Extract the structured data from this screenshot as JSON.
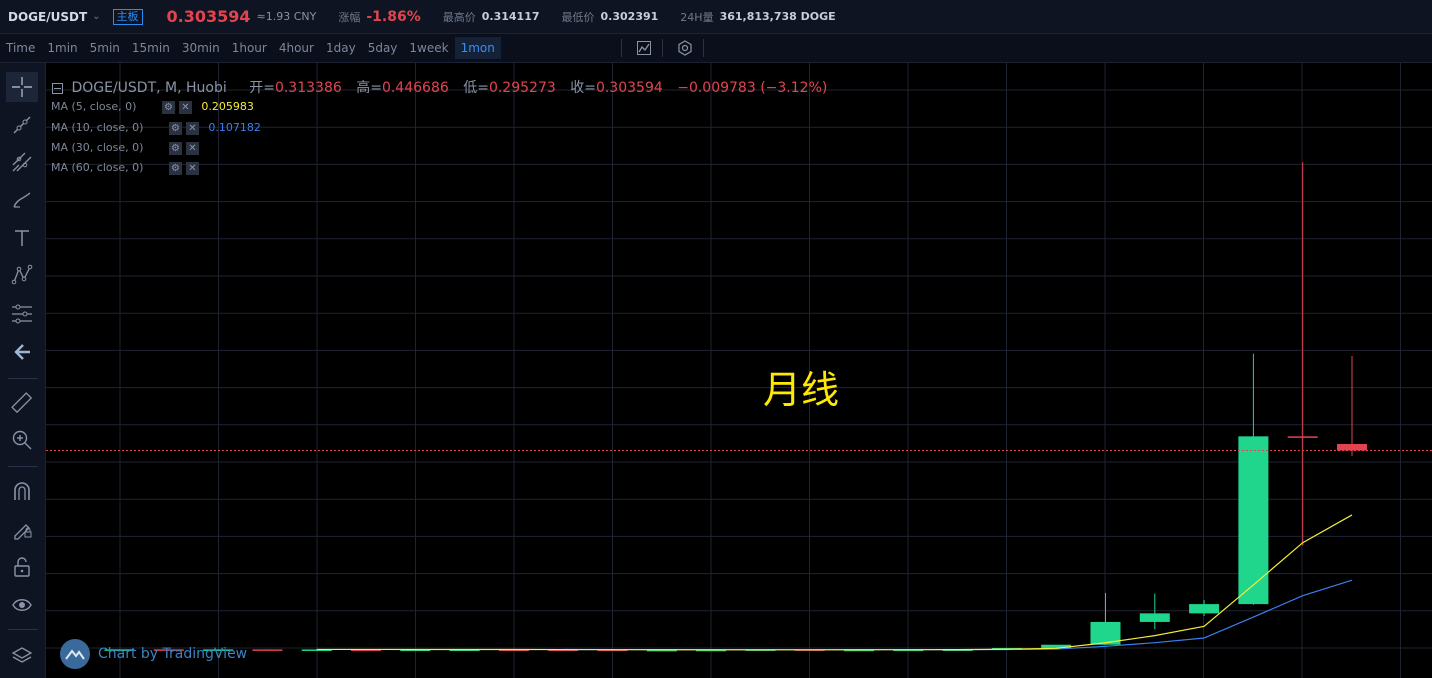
{
  "header": {
    "symbol": "DOGE/USDT",
    "badge": "主板",
    "price": "0.303594",
    "cny": "≈1.93 CNY",
    "change_label": "涨幅",
    "change_value": "-1.86%",
    "high_label": "最高价",
    "high_value": "0.314117",
    "low_label": "最低价",
    "low_value": "0.302391",
    "volume_label": "24H量",
    "volume_value": "361,813,738 DOGE"
  },
  "timeframes": [
    "Time",
    "1min",
    "5min",
    "15min",
    "30min",
    "1hour",
    "4hour",
    "1day",
    "5day",
    "1week",
    "1mon"
  ],
  "active_timeframe": "1mon",
  "legend": {
    "title": "DOGE/USDT, M, Huobi",
    "open_label": "开=",
    "open_value": "0.313386",
    "high_label": "高=",
    "high_value": "0.446686",
    "low_label": "低=",
    "low_value": "0.295273",
    "close_label": "收=",
    "close_value": "0.303594",
    "change": "−0.009783 (−3.12%)"
  },
  "ma": [
    {
      "label": "MA (5, close, 0)",
      "value": "0.205983",
      "color": "#f5ee3a"
    },
    {
      "label": "MA (10, close, 0)",
      "value": "0.107182",
      "color": "#3a7ff0"
    },
    {
      "label": "MA (30, close, 0)",
      "value": ""
    },
    {
      "label": "MA (60, close, 0)",
      "value": ""
    }
  ],
  "watermark": "月线",
  "tv_logo": "Chart by TradingView",
  "colors": {
    "up": "#1fd68c",
    "down": "#e2444f",
    "ma5": "#f5ee3a",
    "ma10": "#3a7ff0",
    "accent": "#3e8cf2"
  },
  "chart_data": {
    "type": "candlestick",
    "symbol": "DOGE/USDT",
    "interval": "M",
    "price_line": 0.303594,
    "candles": [
      {
        "o": 0.0025,
        "h": 0.0026,
        "l": 0.0024,
        "c": 0.0025
      },
      {
        "o": 0.0025,
        "h": 0.0026,
        "l": 0.0024,
        "c": 0.0024
      },
      {
        "o": 0.0024,
        "h": 0.0025,
        "l": 0.0023,
        "c": 0.0024
      },
      {
        "o": 0.0024,
        "h": 0.0025,
        "l": 0.0023,
        "c": 0.0023
      },
      {
        "o": 0.0023,
        "h": 0.0024,
        "l": 0.0022,
        "c": 0.0023
      },
      {
        "o": 0.0023,
        "h": 0.0024,
        "l": 0.0022,
        "c": 0.0022
      },
      {
        "o": 0.0022,
        "h": 0.0023,
        "l": 0.0021,
        "c": 0.0022
      },
      {
        "o": 0.0022,
        "h": 0.0023,
        "l": 0.0021,
        "c": 0.0023
      },
      {
        "o": 0.0023,
        "h": 0.0024,
        "l": 0.0022,
        "c": 0.0022
      },
      {
        "o": 0.0022,
        "h": 0.0023,
        "l": 0.0021,
        "c": 0.0021
      },
      {
        "o": 0.0021,
        "h": 0.0022,
        "l": 0.001,
        "c": 0.0012
      },
      {
        "o": 0.0012,
        "h": 0.002,
        "l": 0.0008,
        "c": 0.0017
      },
      {
        "o": 0.0017,
        "h": 0.0022,
        "l": 0.0013,
        "c": 0.0018
      },
      {
        "o": 0.0018,
        "h": 0.003,
        "l": 0.0016,
        "c": 0.0024
      },
      {
        "o": 0.0024,
        "h": 0.0028,
        "l": 0.0016,
        "c": 0.0018
      },
      {
        "o": 0.0018,
        "h": 0.0022,
        "l": 0.0016,
        "c": 0.0019
      },
      {
        "o": 0.0019,
        "h": 0.0024,
        "l": 0.0017,
        "c": 0.0021
      },
      {
        "o": 0.0021,
        "h": 0.0024,
        "l": 0.0019,
        "c": 0.0023
      },
      {
        "o": 0.0023,
        "h": 0.0048,
        "l": 0.0022,
        "c": 0.0046
      },
      {
        "o": 0.0046,
        "h": 0.0062,
        "l": 0.004,
        "c": 0.0095
      },
      {
        "o": 0.0095,
        "h": 0.088,
        "l": 0.009,
        "c": 0.044
      },
      {
        "o": 0.044,
        "h": 0.087,
        "l": 0.033,
        "c": 0.057
      },
      {
        "o": 0.057,
        "h": 0.077,
        "l": 0.053,
        "c": 0.071
      },
      {
        "o": 0.071,
        "h": 0.45,
        "l": 0.07,
        "c": 0.325
      },
      {
        "o": 0.325,
        "h": 0.74,
        "l": 0.16,
        "c": 0.323
      },
      {
        "o": 0.3134,
        "h": 0.4467,
        "l": 0.2953,
        "c": 0.3036
      }
    ],
    "ma5": [
      null,
      null,
      null,
      null,
      0.0024,
      0.0024,
      0.0023,
      0.0023,
      0.0023,
      0.0022,
      0.002,
      0.0019,
      0.0018,
      0.0018,
      0.0018,
      0.0019,
      0.002,
      0.0021,
      0.0026,
      0.0041,
      0.0125,
      0.0233,
      0.0374,
      0.1,
      0.164,
      0.206
    ],
    "ma10": [
      null,
      null,
      null,
      null,
      null,
      null,
      null,
      null,
      null,
      0.0023,
      0.0022,
      0.0021,
      0.0021,
      0.0021,
      0.002,
      0.002,
      0.002,
      0.002,
      0.0022,
      0.0029,
      0.0071,
      0.0126,
      0.0197,
      0.0514,
      0.0838,
      0.1072
    ]
  }
}
